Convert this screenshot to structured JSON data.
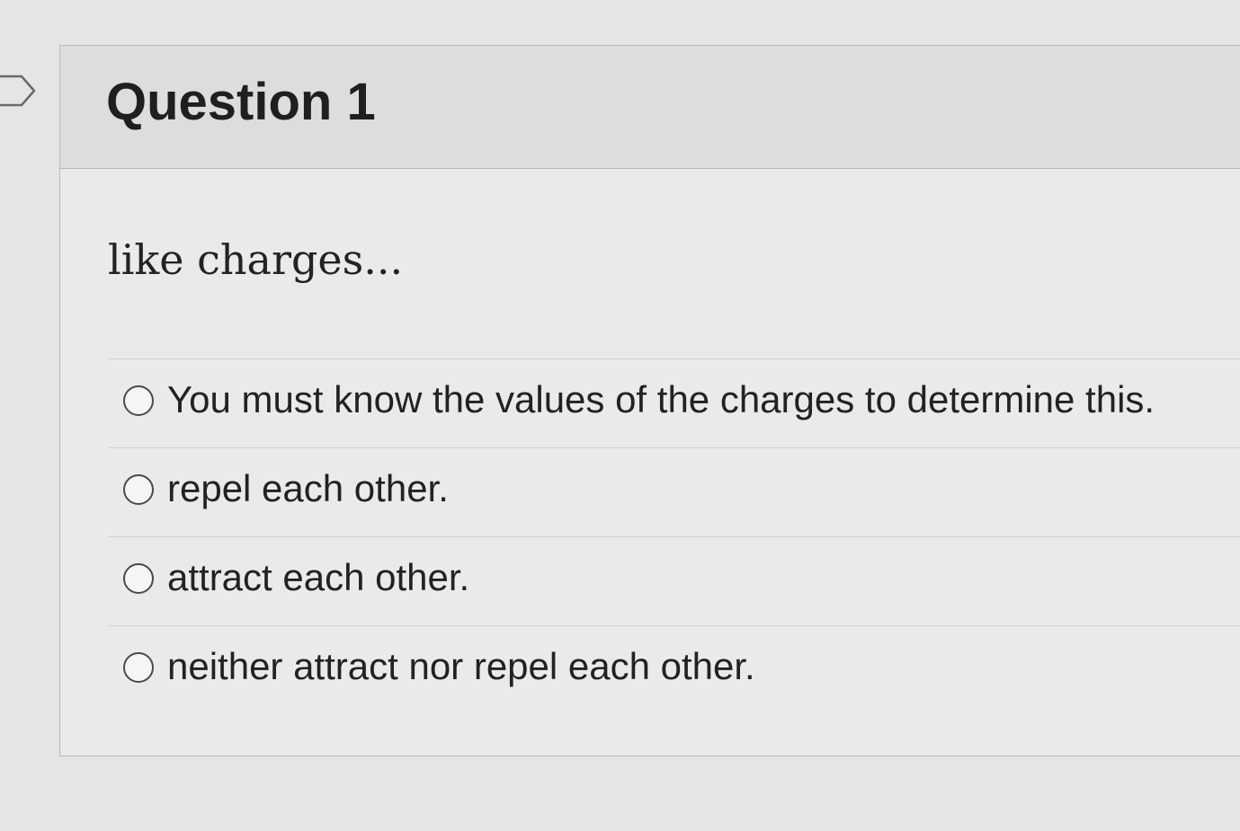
{
  "question": {
    "title": "Question 1",
    "prompt": "like charges...",
    "answers": [
      {
        "label": "You must know the values of the charges to determine this.",
        "selected": false
      },
      {
        "label": "repel each other.",
        "selected": false
      },
      {
        "label": "attract each other.",
        "selected": false
      },
      {
        "label": "neither attract nor repel each other.",
        "selected": false
      }
    ]
  },
  "icons": {
    "flag": "flag-tab-icon",
    "radio": "radio-unchecked-icon"
  },
  "colors": {
    "background": "#e4e6e5",
    "header": "#dcdedd",
    "text": "#222222",
    "border": "#b7bbba"
  }
}
